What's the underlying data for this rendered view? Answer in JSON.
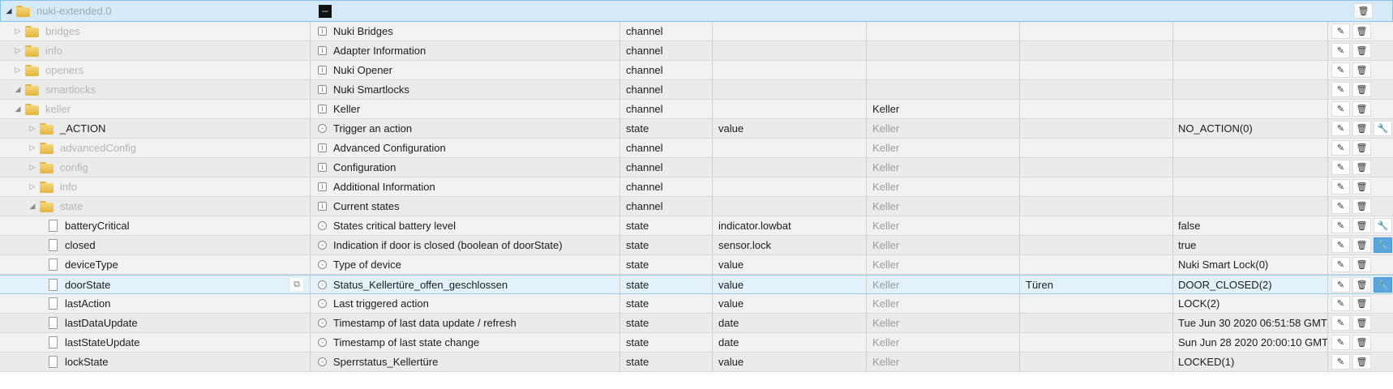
{
  "root": {
    "id": "nuki-extended.0",
    "logo_text": "NUKI"
  },
  "rows": [
    {
      "id": "bridges",
      "name": "Nuki Bridges",
      "type": "channel",
      "role": "",
      "room": "",
      "function": "",
      "value": ""
    },
    {
      "id": "info",
      "name": "Adapter Information",
      "type": "channel",
      "role": "",
      "room": "",
      "function": "",
      "value": ""
    },
    {
      "id": "openers",
      "name": "Nuki Opener",
      "type": "channel",
      "role": "",
      "room": "",
      "function": "",
      "value": ""
    },
    {
      "id": "smartlocks",
      "name": "Nuki Smartlocks",
      "type": "channel",
      "role": "",
      "room": "",
      "function": "",
      "value": ""
    },
    {
      "id": "keller",
      "name": "Keller",
      "type": "channel",
      "role": "",
      "room": "Keller",
      "function": "",
      "value": ""
    },
    {
      "id": "_ACTION",
      "name": "Trigger an action",
      "type": "state",
      "role": "value",
      "room": "Keller",
      "function": "",
      "value": "NO_ACTION(0)"
    },
    {
      "id": "advancedConfig",
      "name": "Advanced Configuration",
      "type": "channel",
      "role": "",
      "room": "Keller",
      "function": "",
      "value": ""
    },
    {
      "id": "config",
      "name": "Configuration",
      "type": "channel",
      "role": "",
      "room": "Keller",
      "function": "",
      "value": ""
    },
    {
      "id": "info",
      "name": "Additional Information",
      "type": "channel",
      "role": "",
      "room": "Keller",
      "function": "",
      "value": ""
    },
    {
      "id": "state",
      "name": "Current states",
      "type": "channel",
      "role": "",
      "room": "Keller",
      "function": "",
      "value": ""
    },
    {
      "id": "batteryCritical",
      "name": "States critical battery level",
      "type": "state",
      "role": "indicator.lowbat",
      "room": "Keller",
      "function": "",
      "value": "false"
    },
    {
      "id": "closed",
      "name": "Indication if door is closed (boolean of doorState)",
      "type": "state",
      "role": "sensor.lock",
      "room": "Keller",
      "function": "",
      "value": "true"
    },
    {
      "id": "deviceType",
      "name": "Type of device",
      "type": "state",
      "role": "value",
      "room": "Keller",
      "function": "",
      "value": "Nuki Smart Lock(0)"
    },
    {
      "id": "doorState",
      "name": "Status_Kellertüre_offen_geschlossen",
      "type": "state",
      "role": "value",
      "room": "Keller",
      "function": "Türen",
      "value": "DOOR_CLOSED(2)"
    },
    {
      "id": "lastAction",
      "name": "Last triggered action",
      "type": "state",
      "role": "value",
      "room": "Keller",
      "function": "",
      "value": "LOCK(2)"
    },
    {
      "id": "lastDataUpdate",
      "name": "Timestamp of last data update / refresh",
      "type": "state",
      "role": "date",
      "room": "Keller",
      "function": "",
      "value": "Tue Jun 30 2020 06:51:58 GMT"
    },
    {
      "id": "lastStateUpdate",
      "name": "Timestamp of last state change",
      "type": "state",
      "role": "date",
      "room": "Keller",
      "function": "",
      "value": "Sun Jun 28 2020 20:00:10 GMT"
    },
    {
      "id": "lockState",
      "name": "Sperrstatus_Kellertüre",
      "type": "state",
      "role": "value",
      "room": "Keller",
      "function": "",
      "value": "LOCKED(1)"
    }
  ],
  "icons": {
    "edit": "pencil-icon",
    "delete": "trash-icon",
    "custom": "wrench-icon",
    "copy": "copy-icon"
  }
}
